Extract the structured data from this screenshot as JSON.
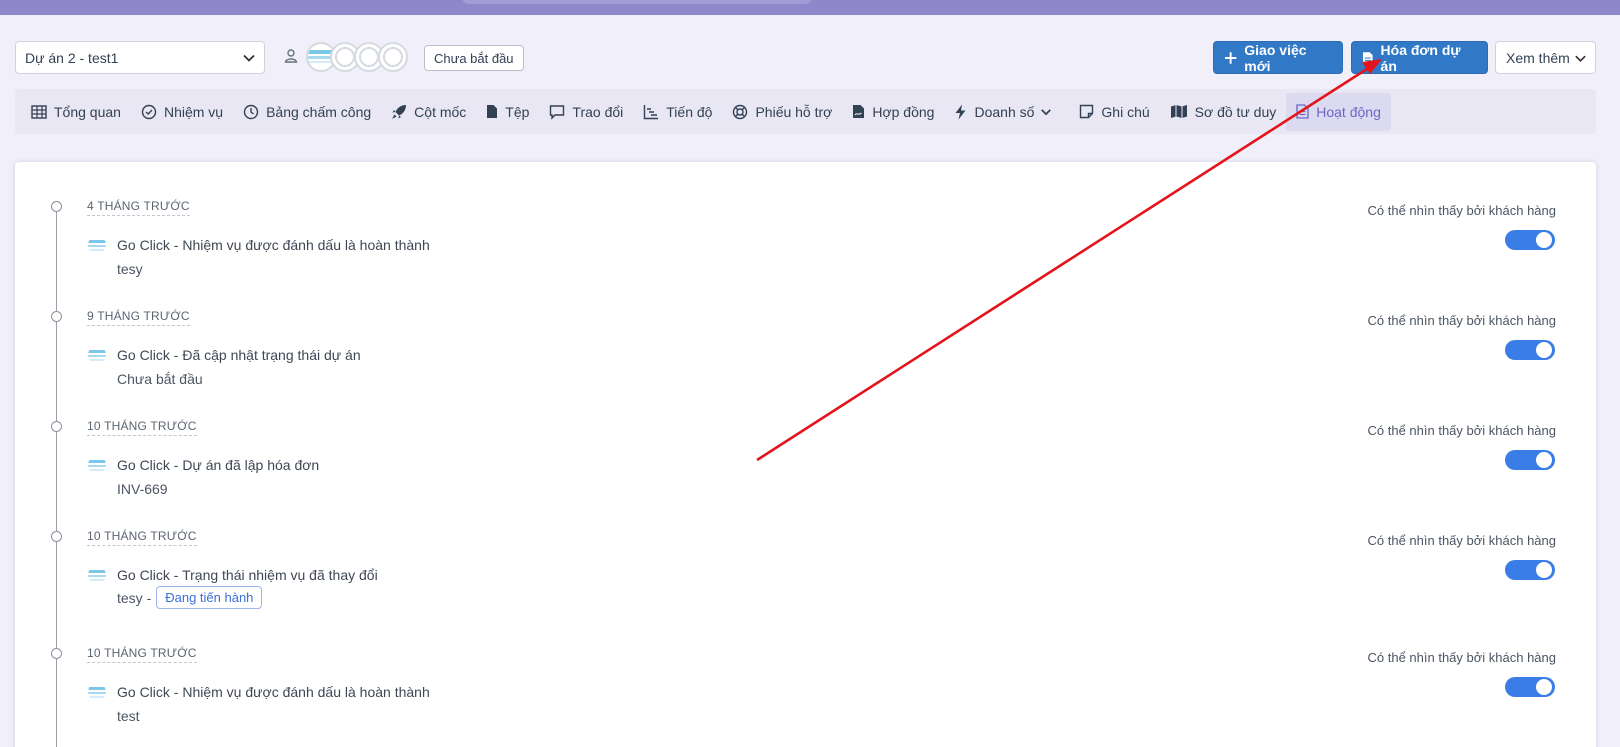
{
  "project_select": {
    "value": "Dự án 2 - test1"
  },
  "project_status": {
    "label": "Chưa bắt đầu"
  },
  "header_buttons": {
    "assign_label": "Giao việc mới",
    "invoice_label": "Hóa đơn dự án",
    "more_label": "Xem thêm"
  },
  "tabs": [
    {
      "label": "Tổng quan",
      "icon": "table-icon"
    },
    {
      "label": "Nhiệm vụ",
      "icon": "check-circle-icon"
    },
    {
      "label": "Bảng chấm công",
      "icon": "clock-icon"
    },
    {
      "label": "Cột mốc",
      "icon": "rocket-icon"
    },
    {
      "label": "Tệp",
      "icon": "file-icon"
    },
    {
      "label": "Trao đổi",
      "icon": "chat-icon"
    },
    {
      "label": "Tiến độ",
      "icon": "gantt-icon"
    },
    {
      "label": "Phiếu hỗ trợ",
      "icon": "lifebuoy-icon"
    },
    {
      "label": "Hợp đồng",
      "icon": "contract-icon"
    },
    {
      "label": "Doanh số",
      "icon": "bolt-icon"
    },
    {
      "label": "Ghi chú",
      "icon": "note-icon"
    },
    {
      "label": "Sơ đồ tư duy",
      "icon": "map-icon"
    },
    {
      "label": "Hoạt động",
      "icon": "document-icon"
    }
  ],
  "activities": [
    {
      "time": "4 THÁNG TRƯỚC",
      "title": "Go Click - Nhiệm vụ được đánh dấu là hoàn thành",
      "desc": "tesy",
      "visibility_label": "Có thể nhìn thấy bởi khách hàng",
      "visible": true
    },
    {
      "time": "9 THÁNG TRƯỚC",
      "title": "Go Click - Đã cập nhật trạng thái dự án",
      "desc": "Chưa bắt đầu",
      "visibility_label": "Có thể nhìn thấy bởi khách hàng",
      "visible": true
    },
    {
      "time": "10 THÁNG TRƯỚC",
      "title": "Go Click - Dự án đã lập hóa đơn",
      "desc": "INV-669",
      "visibility_label": "Có thể nhìn thấy bởi khách hàng",
      "visible": true
    },
    {
      "time": "10 THÁNG TRƯỚC",
      "title": "Go Click - Trạng thái nhiệm vụ đã thay đổi",
      "desc": "tesy -",
      "badge": "Đang tiến hành",
      "visibility_label": "Có thể nhìn thấy bởi khách hàng",
      "visible": true
    },
    {
      "time": "10 THÁNG TRƯỚC",
      "title": "Go Click - Nhiệm vụ được đánh dấu là hoàn thành",
      "desc": "test",
      "visibility_label": "Có thể nhìn thấy bởi khách hàng",
      "visible": true
    }
  ],
  "colors": {
    "primary": "#3178c6",
    "active_tab": "#6a66c5",
    "toggle_on": "#3b7de6",
    "annotation_arrow": "#e3141b"
  }
}
